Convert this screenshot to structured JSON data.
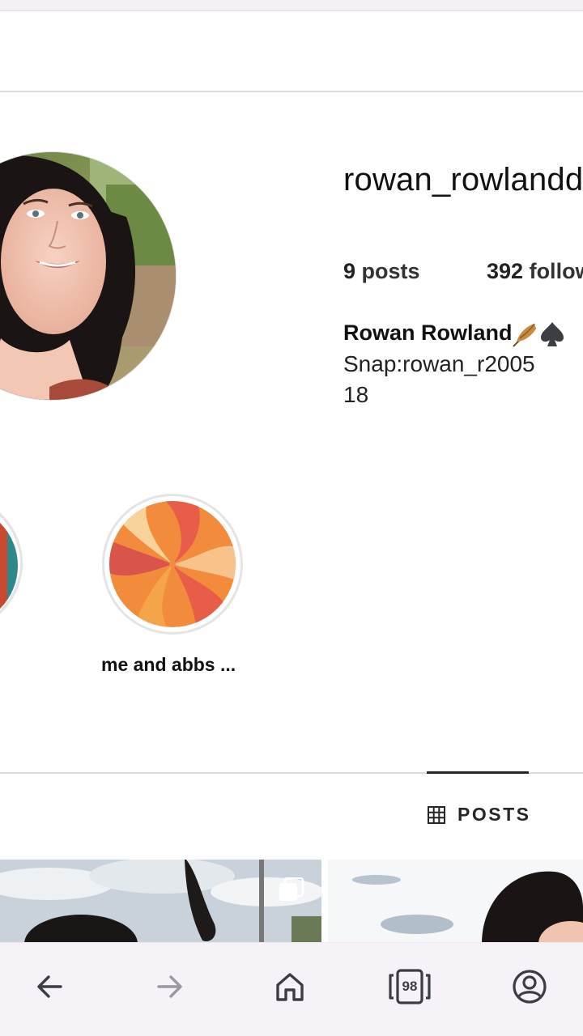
{
  "profile": {
    "username": "rowan_rowlandd",
    "stats": {
      "posts_count": "9",
      "posts_label": "posts",
      "followers_count": "392",
      "followers_label": "follow"
    },
    "bio": {
      "name": "Rowan Rowland",
      "emoji_icons": [
        "feather-icon",
        "spade-icon"
      ],
      "lines": [
        "Snap:rowan_r2005",
        "18"
      ]
    }
  },
  "highlights": [
    {
      "label": "",
      "icon": "rainbow-stripes"
    },
    {
      "label": "me and abbs ...",
      "icon": "swirl-pattern"
    }
  ],
  "tabs": {
    "active": "POSTS",
    "posts_label": "POSTS"
  },
  "browser_nav": {
    "items": [
      "back-icon",
      "forward-icon",
      "home-icon",
      "tab-switcher-icon",
      "account-icon"
    ],
    "tab_count": "98",
    "forward_enabled": false
  },
  "colors": {
    "nav_bg": "#f6f2f8",
    "nav_icon": "#3c3c44",
    "nav_icon_disabled": "#9a98a0",
    "divider": "#dbdbdb"
  }
}
